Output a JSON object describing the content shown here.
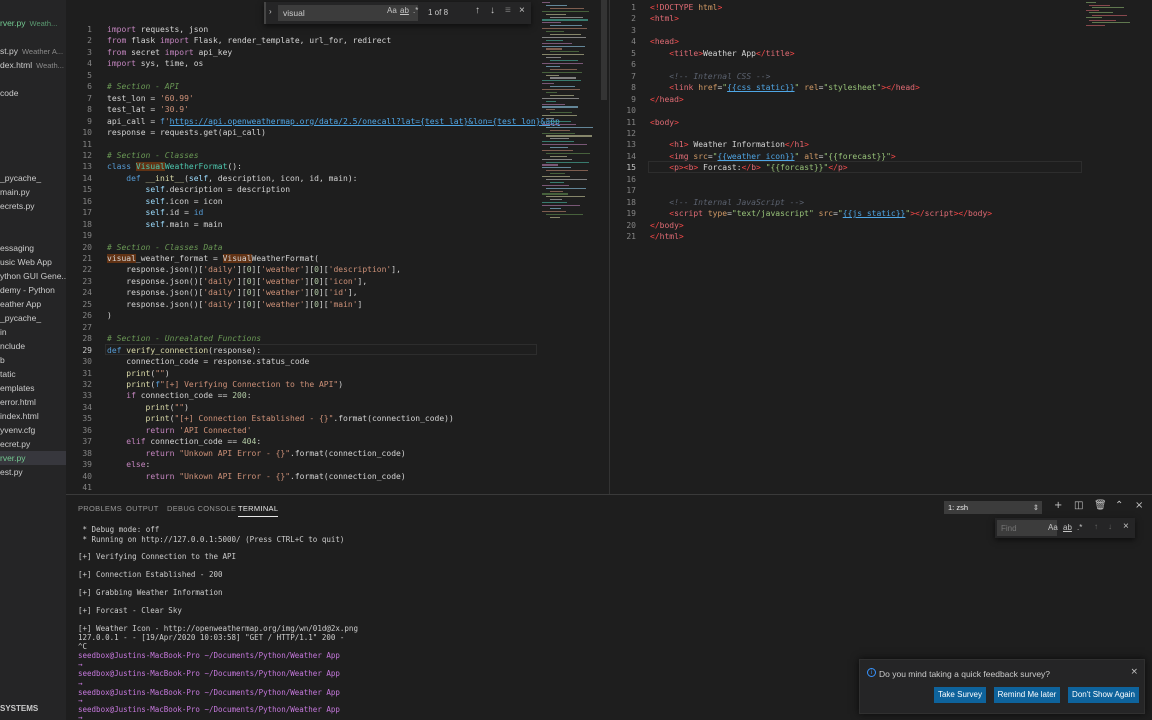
{
  "sidebar": {
    "items": [
      {
        "label": "rver.py",
        "suffix": "Weath...",
        "state": "mod"
      },
      {
        "label": "st.py",
        "suffix": "Weather A...",
        "state": ""
      },
      {
        "label": "dex.html",
        "suffix": "Weath...",
        "state": ""
      },
      {
        "label": "code",
        "suffix": "",
        "state": ""
      },
      {
        "label": "_pycache_",
        "suffix": "",
        "state": ""
      },
      {
        "label": "main.py",
        "suffix": "",
        "state": ""
      },
      {
        "label": "ecrets.py",
        "suffix": "",
        "state": ""
      },
      {
        "label": "essaging",
        "suffix": "",
        "state": ""
      },
      {
        "label": "usic Web App",
        "suffix": "",
        "state": ""
      },
      {
        "label": "ython GUI Gene...",
        "suffix": "",
        "state": ""
      },
      {
        "label": "demy - Python",
        "suffix": "",
        "state": ""
      },
      {
        "label": "eather App",
        "suffix": "",
        "state": ""
      },
      {
        "label": "_pycache_",
        "suffix": "",
        "state": ""
      },
      {
        "label": "in",
        "suffix": "",
        "state": ""
      },
      {
        "label": "nclude",
        "suffix": "",
        "state": ""
      },
      {
        "label": "b",
        "suffix": "",
        "state": ""
      },
      {
        "label": "tatic",
        "suffix": "",
        "state": ""
      },
      {
        "label": "emplates",
        "suffix": "",
        "state": ""
      },
      {
        "label": "error.html",
        "suffix": "",
        "state": ""
      },
      {
        "label": "index.html",
        "suffix": "",
        "state": ""
      },
      {
        "label": "yvenv.cfg",
        "suffix": "",
        "state": ""
      },
      {
        "label": "ecret.py",
        "suffix": "",
        "state": ""
      },
      {
        "label": "rver.py",
        "suffix": "",
        "state": "mod"
      },
      {
        "label": "est.py",
        "suffix": "",
        "state": ""
      }
    ],
    "footer": "SYSTEMS"
  },
  "find": {
    "value": "visual",
    "count": "1 of 8",
    "aa": "Aa",
    "word": "ab",
    "regex": ".*"
  },
  "left_editor": {
    "lines": [
      {
        "n": "1",
        "html": "<span class='kw'>import</span> requests, json"
      },
      {
        "n": "2",
        "html": "<span class='kw'>from</span> flask <span class='kw'>import</span> Flask, render_template, url_for, redirect"
      },
      {
        "n": "3",
        "html": "<span class='kw'>from</span> secret <span class='kw'>import</span> api_key"
      },
      {
        "n": "4",
        "html": "<span class='kw'>import</span> sys, time, os"
      },
      {
        "n": "5",
        "html": ""
      },
      {
        "n": "6",
        "html": "<span class='cmt'># Section - API</span>"
      },
      {
        "n": "7",
        "html": "test_lon = <span class='str'>'60.99'</span>"
      },
      {
        "n": "8",
        "html": "test_lat = <span class='str'>'30.9'</span>"
      },
      {
        "n": "9",
        "html": "api_call = <span class='kw2'>f</span><span class='str'>'</span><span class='url'>https://api.openweathermap.org/data/2.5/onecall?lat={test_lat}&lon={test_lon}&app</span>"
      },
      {
        "n": "10",
        "html": "response = requests.get(api_call)"
      },
      {
        "n": "11",
        "html": ""
      },
      {
        "n": "12",
        "html": "<span class='cmt'># Section - Classes</span>"
      },
      {
        "n": "13",
        "html": "<span class='kw2'>class</span> <span class='cls match'>Visual</span><span class='cls'>WeatherFormat</span>():"
      },
      {
        "n": "14",
        "html": "    <span class='kw2'>def</span> <span class='fn'>__init__</span>(<span class='var'>self</span>, description, icon, id, main):"
      },
      {
        "n": "15",
        "html": "        <span class='var'>self</span>.description = description"
      },
      {
        "n": "16",
        "html": "        <span class='var'>self</span>.icon = icon"
      },
      {
        "n": "17",
        "html": "        <span class='var'>self</span>.id = <span class='kw2'>id</span>"
      },
      {
        "n": "18",
        "html": "        <span class='var'>self</span>.main = main"
      },
      {
        "n": "19",
        "html": ""
      },
      {
        "n": "20",
        "html": "<span class='cmt'># Section - Classes Data</span>"
      },
      {
        "n": "21",
        "html": "<span class='match'>visual</span>_weather_format = <span class='match'>Visual</span>WeatherFormat("
      },
      {
        "n": "22",
        "html": "    response.json()[<span class='str'>'daily'</span>][<span class='num'>0</span>][<span class='str'>'weather'</span>][<span class='num'>0</span>][<span class='str'>'description'</span>],"
      },
      {
        "n": "23",
        "html": "    response.json()[<span class='str'>'daily'</span>][<span class='num'>0</span>][<span class='str'>'weather'</span>][<span class='num'>0</span>][<span class='str'>'icon'</span>],"
      },
      {
        "n": "24",
        "html": "    response.json()[<span class='str'>'daily'</span>][<span class='num'>0</span>][<span class='str'>'weather'</span>][<span class='num'>0</span>][<span class='str'>'id'</span>],"
      },
      {
        "n": "25",
        "html": "    response.json()[<span class='str'>'daily'</span>][<span class='num'>0</span>][<span class='str'>'weather'</span>][<span class='num'>0</span>][<span class='str'>'main'</span>]"
      },
      {
        "n": "26",
        "html": ")"
      },
      {
        "n": "27",
        "html": ""
      },
      {
        "n": "28",
        "html": "<span class='cmt'># Section - Unrealated Functions</span>"
      },
      {
        "n": "29",
        "html": "<span class='kw2'>def</span> <span class='fn'>verify_connection</span>(response):"
      },
      {
        "n": "30",
        "html": "    connection_code = response.status_code"
      },
      {
        "n": "31",
        "html": "    <span class='fn'>print</span>(<span class='str'>\"\"</span>)"
      },
      {
        "n": "32",
        "html": "    <span class='fn'>print</span>(<span class='kw2'>f</span><span class='str'>\"[+] Verifying Connection to the API\"</span>)"
      },
      {
        "n": "33",
        "html": "    <span class='kw'>if</span> connection_code == <span class='num'>200</span>:"
      },
      {
        "n": "34",
        "html": "        <span class='fn'>print</span>(<span class='str'>\"\"</span>)"
      },
      {
        "n": "35",
        "html": "        <span class='fn'>print</span>(<span class='str'>\"[+] Connection Established - {}\"</span>.format(connection_code))"
      },
      {
        "n": "36",
        "html": "        <span class='kw'>return</span> <span class='str'>'API Connected'</span>"
      },
      {
        "n": "37",
        "html": "    <span class='kw'>elif</span> connection_code == <span class='num'>404</span>:"
      },
      {
        "n": "38",
        "html": "        <span class='kw'>return</span> <span class='str'>\"Unkown API Error - {}\"</span>.format(connection_code)"
      },
      {
        "n": "39",
        "html": "    <span class='kw'>else</span>:"
      },
      {
        "n": "40",
        "html": "        <span class='kw'>return</span> <span class='str'>\"Unkown API Error - {}\"</span>.format(connection_code)"
      },
      {
        "n": "41",
        "html": ""
      }
    ]
  },
  "right_editor": {
    "lines": [
      {
        "n": "1",
        "html": "<span class='tag'>&lt;!</span><span class='tagn'>DOCTYPE</span> <span class='hattr'>html</span><span class='tag'>&gt;</span>"
      },
      {
        "n": "2",
        "html": "<span class='tag'>&lt;</span><span class='tagn'>html</span><span class='tag'>&gt;</span>"
      },
      {
        "n": "3",
        "html": ""
      },
      {
        "n": "4",
        "html": "<span class='tag'>&lt;</span><span class='tagn'>head</span><span class='tag'>&gt;</span>"
      },
      {
        "n": "5",
        "html": "    <span class='tag'>&lt;</span><span class='tagn'>title</span><span class='tag'>&gt;</span>Weather App<span class='tag'>&lt;/</span><span class='tagn'>title</span><span class='tag'>&gt;</span>"
      },
      {
        "n": "6",
        "html": ""
      },
      {
        "n": "7",
        "html": "    <span class='hcmt'>&lt;!-- Internal CSS --&gt;</span>"
      },
      {
        "n": "8",
        "html": "    <span class='tag'>&lt;</span><span class='tagn'>link</span> <span class='hattr'>href</span>=<span class='hstr'>\"</span><span class='url'>{{css_static}}</span><span class='hstr'>\"</span> <span class='hattr'>rel</span>=<span class='hstr'>\"stylesheet\"</span><span class='tag'>&gt;&lt;/</span><span class='tagn'>head</span><span class='tag'>&gt;</span>"
      },
      {
        "n": "9",
        "html": "<span class='tag'>&lt;/</span><span class='tagn'>head</span><span class='tag'>&gt;</span>"
      },
      {
        "n": "10",
        "html": ""
      },
      {
        "n": "11",
        "html": "<span class='tag'>&lt;</span><span class='tagn'>body</span><span class='tag'>&gt;</span>"
      },
      {
        "n": "12",
        "html": ""
      },
      {
        "n": "13",
        "html": "    <span class='tag'>&lt;</span><span class='tagn'>h1</span><span class='tag'>&gt;</span> Weather Information<span class='tag'>&lt;/</span><span class='tagn'>h1</span><span class='tag'>&gt;</span>"
      },
      {
        "n": "14",
        "html": "    <span class='tag'>&lt;</span><span class='tagn'>img</span> <span class='hattr'>src</span>=<span class='hstr'>\"</span><span class='url'>{{weather_icon}}</span><span class='hstr'>\"</span> <span class='hattr'>alt</span>=<span class='hstr'>\"{{forecast}}\"</span><span class='tag'>&gt;</span>"
      },
      {
        "n": "15",
        "html": "    <span class='tag'>&lt;</span><span class='tagn'>p</span><span class='tag'>&gt;&lt;</span><span class='tagn'>b</span><span class='tag'>&gt;</span> Forcast:<span class='tag'>&lt;/</span><span class='tagn'>b</span><span class='tag'>&gt;</span> <span class='hstr'>\"{{forcast}}\"</span><span class='tag'>&lt;/</span><span class='tagn'>p</span><span class='tag'>&gt;</span>"
      },
      {
        "n": "16",
        "html": ""
      },
      {
        "n": "17",
        "html": ""
      },
      {
        "n": "18",
        "html": "    <span class='hcmt'>&lt;!-- Internal JavaScript --&gt;</span>"
      },
      {
        "n": "19",
        "html": "    <span class='tag'>&lt;</span><span class='tagn'>script</span> <span class='hattr'>type</span>=<span class='hstr'>\"text/javascript\"</span> <span class='hattr'>src</span>=<span class='hstr'>\"</span><span class='url'>{{js_static}}</span><span class='hstr'>\"</span><span class='tag'>&gt;&lt;/</span><span class='tagn'>script</span><span class='tag'>&gt;&lt;/</span><span class='tagn'>body</span><span class='tag'>&gt;</span>"
      },
      {
        "n": "20",
        "html": "<span class='tag'>&lt;/</span><span class='tagn'>body</span><span class='tag'>&gt;</span>"
      },
      {
        "n": "21",
        "html": "<span class='tag'>&lt;/</span><span class='tagn'>html</span><span class='tag'>&gt;</span>"
      }
    ]
  },
  "panel": {
    "tabs": [
      "PROBLEMS",
      "OUTPUT",
      "DEBUG CONSOLE",
      "TERMINAL"
    ],
    "active_tab": "TERMINAL",
    "terminal_select": "1: zsh",
    "find_placeholder": "Find",
    "terminal_lines": [
      {
        "t": " * Debug mode: off",
        "kind": "plain"
      },
      {
        "t": " * Running on http://127.0.0.1:5000/ (Press CTRL+C to quit)",
        "kind": "plain"
      },
      {
        "t": "",
        "kind": "plain"
      },
      {
        "t": "[+] Verifying Connection to the API",
        "kind": "plain"
      },
      {
        "t": "",
        "kind": "plain"
      },
      {
        "t": "[+] Connection Established - 200",
        "kind": "plain"
      },
      {
        "t": "",
        "kind": "plain"
      },
      {
        "t": "[+] Grabbing Weather Information",
        "kind": "plain"
      },
      {
        "t": "",
        "kind": "plain"
      },
      {
        "t": "[+] Forcast - Clear Sky",
        "kind": "plain"
      },
      {
        "t": "",
        "kind": "plain"
      },
      {
        "t": "[+] Weather Icon - http://openweathermap.org/img/wn/01d@2x.png",
        "kind": "plain"
      },
      {
        "t": "127.0.0.1 - - [19/Apr/2020 10:03:58] \"GET / HTTP/1.1\" 200 -",
        "kind": "plain"
      },
      {
        "t": "^C",
        "kind": "plain"
      },
      {
        "t": "seedbox@Justins-MacBook-Pro",
        "path": "~/Documents/Python/Weather App",
        "kind": "prompt"
      },
      {
        "t": "→",
        "kind": "arrow"
      },
      {
        "t": "seedbox@Justins-MacBook-Pro",
        "path": "~/Documents/Python/Weather App",
        "kind": "prompt"
      },
      {
        "t": "→",
        "kind": "arrow"
      },
      {
        "t": "seedbox@Justins-MacBook-Pro",
        "path": "~/Documents/Python/Weather App",
        "kind": "prompt"
      },
      {
        "t": "→",
        "kind": "arrow"
      },
      {
        "t": "seedbox@Justins-MacBook-Pro",
        "path": "~/Documents/Python/Weather App",
        "kind": "prompt"
      },
      {
        "t": "→",
        "kind": "arrow"
      }
    ]
  },
  "notification": {
    "message": "Do you mind taking a quick feedback survey?",
    "buttons": [
      "Take Survey",
      "Remind Me later",
      "Don't Show Again"
    ]
  },
  "colors": {
    "accent": "#0e639c",
    "bg": "#1e1e1e",
    "sidebar": "#252526"
  }
}
